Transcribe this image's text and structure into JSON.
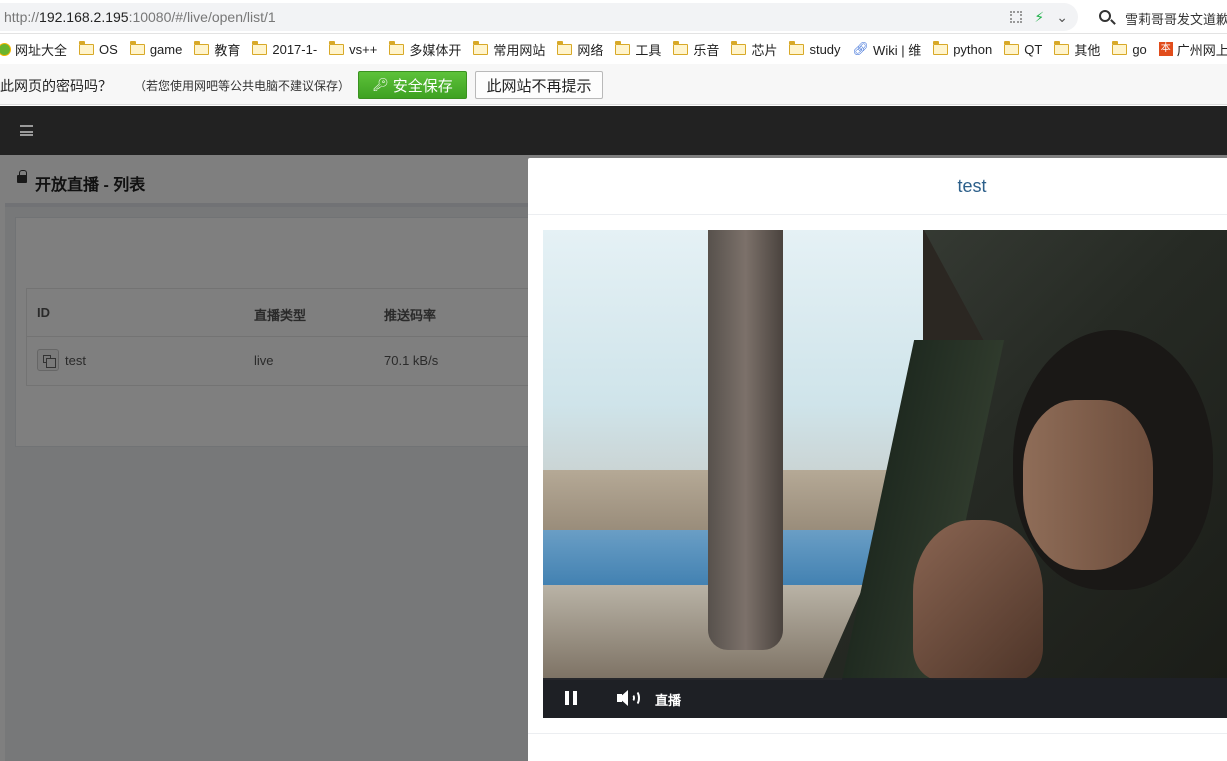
{
  "browser": {
    "url_prefix": "http://",
    "url_host": "192.168.2.195",
    "url_rest": ":10080/#/live/open/list/1",
    "search_text": "雪莉哥哥发文道歉",
    "bookmarks": [
      {
        "label": "网址大全",
        "icon": "globe-icon"
      },
      {
        "label": "OS",
        "icon": "folder-icon"
      },
      {
        "label": "game",
        "icon": "folder-icon"
      },
      {
        "label": "教育",
        "icon": "folder-icon"
      },
      {
        "label": "2017-1-",
        "icon": "folder-icon"
      },
      {
        "label": "vs++",
        "icon": "folder-icon"
      },
      {
        "label": "多媒体开",
        "icon": "folder-icon"
      },
      {
        "label": "常用网站",
        "icon": "folder-icon"
      },
      {
        "label": "网络",
        "icon": "folder-icon"
      },
      {
        "label": "工具",
        "icon": "folder-icon"
      },
      {
        "label": "乐音",
        "icon": "folder-icon"
      },
      {
        "label": "芯片",
        "icon": "folder-icon"
      },
      {
        "label": "study",
        "icon": "folder-icon"
      },
      {
        "label": "Wiki | 维",
        "icon": "link-icon"
      },
      {
        "label": "python",
        "icon": "folder-icon"
      },
      {
        "label": "QT",
        "icon": "folder-icon"
      },
      {
        "label": "其他",
        "icon": "folder-icon"
      },
      {
        "label": "go",
        "icon": "folder-icon"
      },
      {
        "label": "广州网上",
        "icon": "gz-icon"
      }
    ],
    "password_bar": {
      "question": "此网页的密码吗？",
      "hint": "（若您使用网吧等公共电脑不建议保存）",
      "save_label": "安全保存",
      "never_label": "此网站不再提示"
    }
  },
  "page": {
    "title": "开放直播 - 列表",
    "table": {
      "headers": [
        "ID",
        "直播类型",
        "推送码率"
      ],
      "rows": [
        {
          "id": "test",
          "type": "live",
          "bitrate": "70.1 kB/s"
        }
      ]
    }
  },
  "modal": {
    "title": "test",
    "player": {
      "live_label": "直播"
    }
  },
  "colors": {
    "save_button": "#4bb22c",
    "topnav": "#222222",
    "modal_title": "#2c5f8a"
  }
}
